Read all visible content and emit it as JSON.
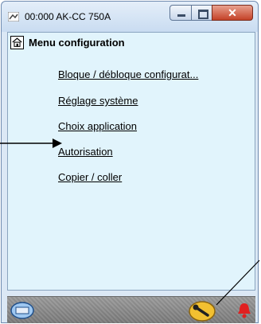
{
  "window": {
    "title": "00:000 AK-CC 750A"
  },
  "header": {
    "title": "Menu configuration"
  },
  "menu": {
    "items": [
      {
        "label": "Bloque / débloque configurat..."
      },
      {
        "label": "Réglage système"
      },
      {
        "label": "Choix application"
      },
      {
        "label": "Autorisation"
      },
      {
        "label": "Copier / coller"
      }
    ]
  },
  "toolbar": {
    "left_icon": "device-icon",
    "center_icon": "wrench-icon",
    "right_icon": "alarm-bell-icon"
  },
  "colors": {
    "client_bg": "#e1f4fc",
    "close_button": "#c44127",
    "wrench_bg": "#f2c031",
    "alarm": "#e02020"
  }
}
